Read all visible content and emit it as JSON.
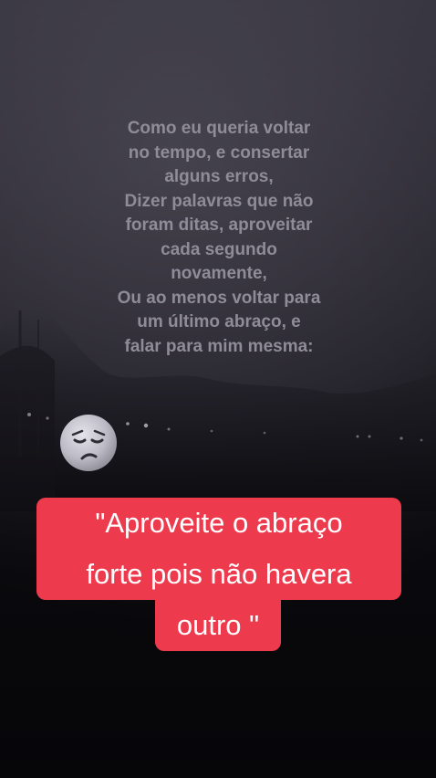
{
  "poem": {
    "lines": [
      "Como eu queria voltar",
      "no tempo, e consertar",
      "alguns erros,",
      "Dizer palavras que não",
      "foram ditas, aproveitar",
      "cada segundo",
      "novamente,",
      "Ou ao menos voltar para",
      "um último abraço, e",
      "falar para mim mesma:"
    ]
  },
  "emoji": {
    "icon": "sad-face-icon"
  },
  "quote": {
    "line1": "\"Aproveite o abraço",
    "line2": "forte pois não havera",
    "line3": "outro \""
  },
  "colors": {
    "highlight": "#ee3a4d",
    "poem_text": "#8f8c97",
    "quote_text": "#ffffff"
  }
}
